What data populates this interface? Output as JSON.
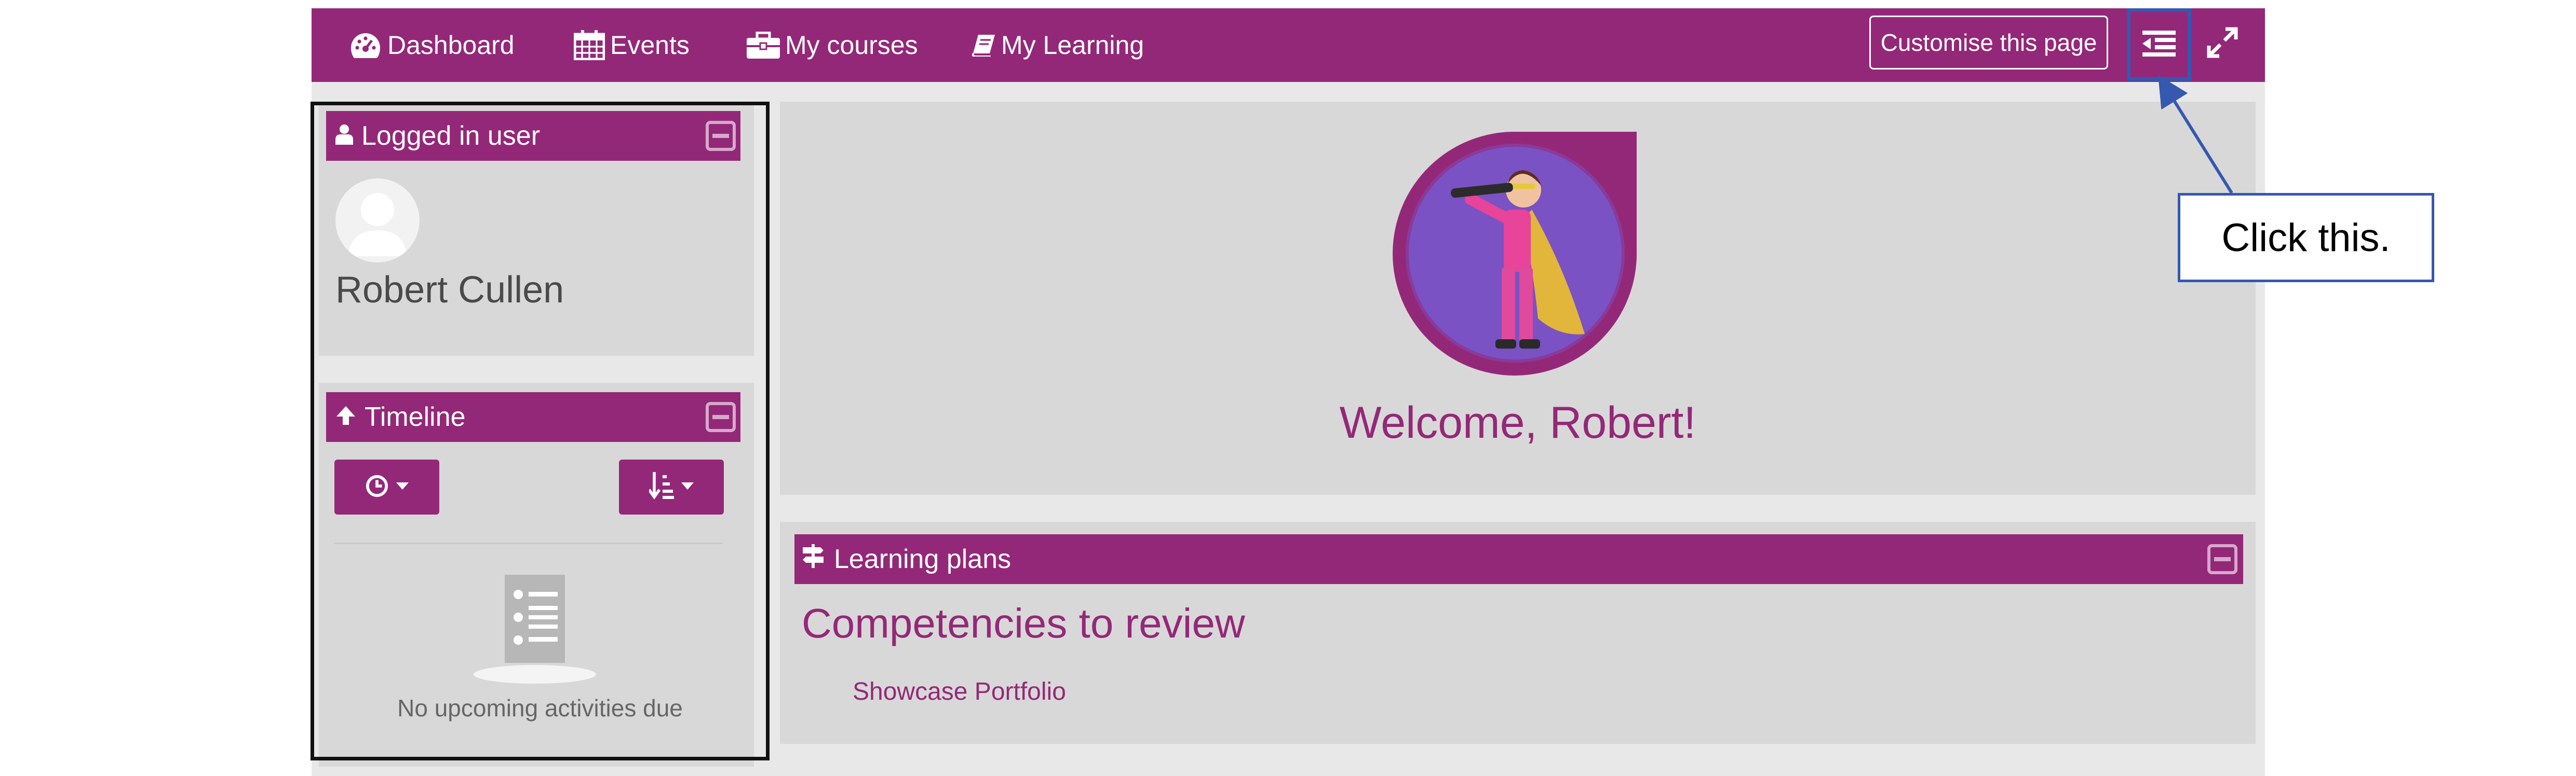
{
  "navbar": {
    "items": [
      {
        "label": "Dashboard",
        "icon": "dashboard-icon"
      },
      {
        "label": "Events",
        "icon": "calendar-icon"
      },
      {
        "label": "My courses",
        "icon": "briefcase-icon"
      },
      {
        "label": "My Learning",
        "icon": "book-icon"
      }
    ],
    "customise_label": "Customise this page",
    "drawer_toggle_icon": "list-indent-icon",
    "fullscreen_icon": "expand-icon"
  },
  "logged_in_block": {
    "title": "Logged in user",
    "user_name": "Robert Cullen"
  },
  "timeline_block": {
    "title": "Timeline",
    "empty_text": "No upcoming activities due"
  },
  "welcome": {
    "text": "Welcome, Robert!"
  },
  "learning_plans": {
    "title": "Learning plans",
    "heading": "Competencies to review",
    "link": "Showcase Portfolio"
  },
  "annotation": {
    "callout_text": "Click this."
  },
  "colors": {
    "brand": "#942878",
    "panel": "#d8d8d8",
    "page": "#e8e8e8",
    "annotation_blue": "#3558b0"
  }
}
